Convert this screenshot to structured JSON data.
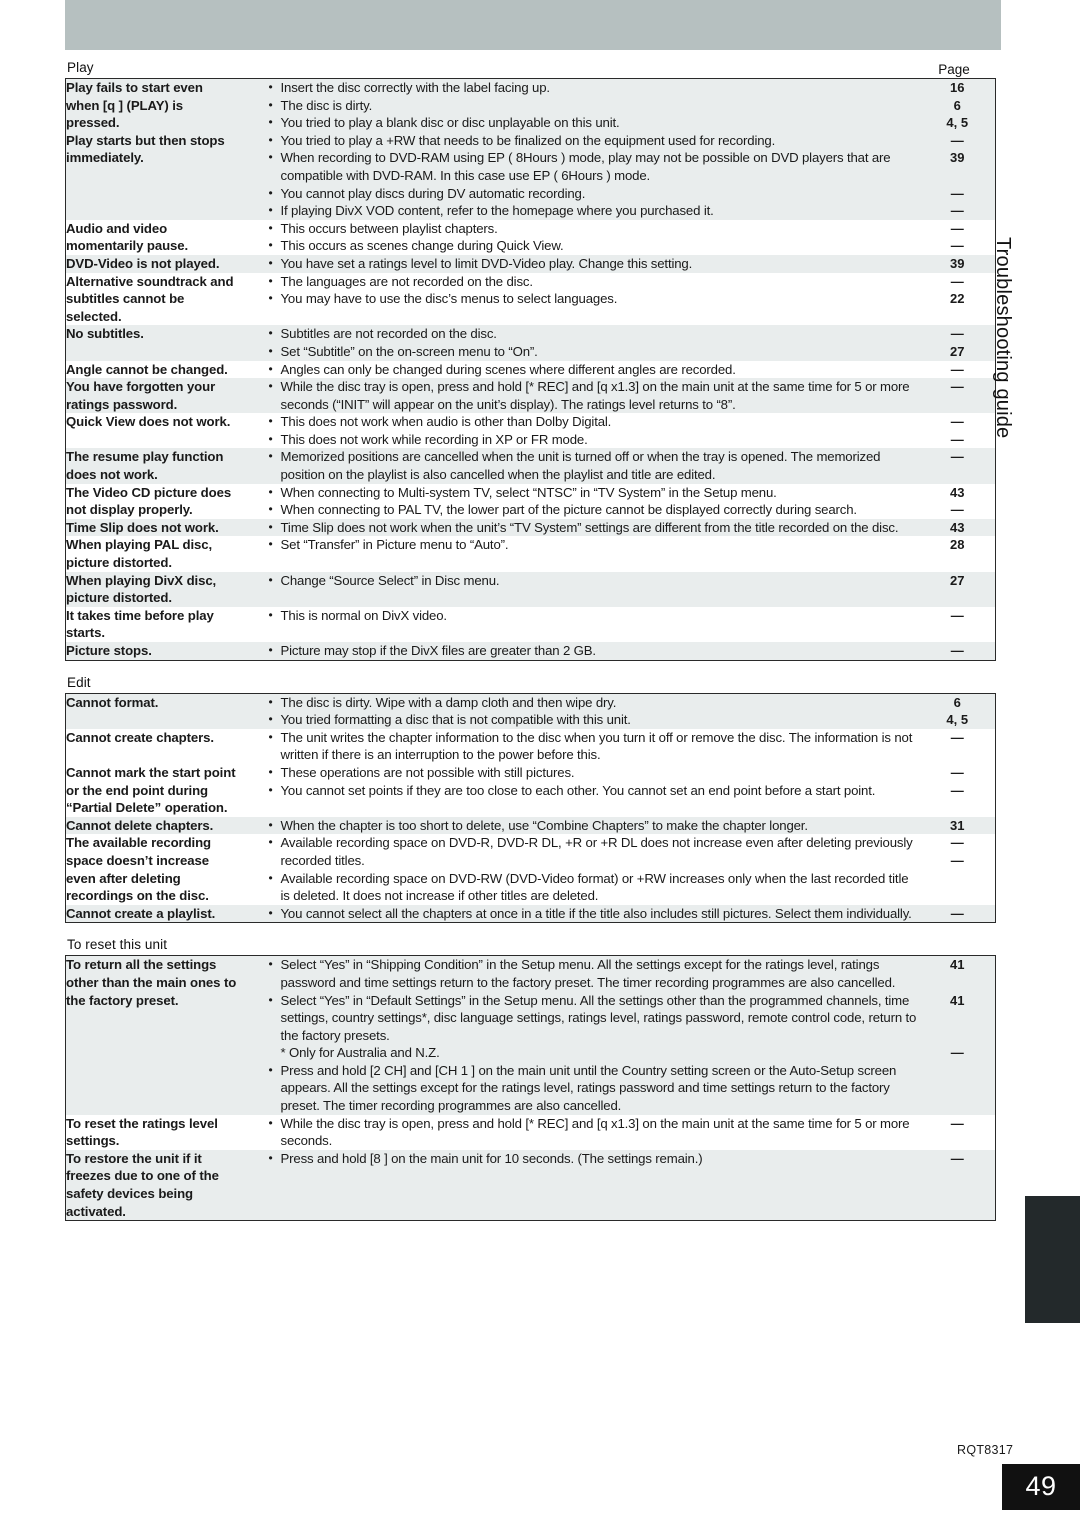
{
  "document": {
    "side_title": "Troubleshooting guide",
    "doc_code": "RQT8317",
    "page_number": "49",
    "page_column_header": "Page"
  },
  "sections": [
    {
      "label": "Play",
      "rows": [
        {
          "shaded": true,
          "symptom": [
            "Play fails to start even",
            "when [q ] (PLAY) is",
            "pressed.",
            "Play starts but then stops",
            "immediately."
          ],
          "remedies": [
            {
              "text": "Insert the disc correctly with the label facing up.",
              "bullet": true
            },
            {
              "text": "The disc is dirty.",
              "bullet": true
            },
            {
              "text": "You tried to play a blank disc or disc unplayable on this unit.",
              "bullet": true
            },
            {
              "text": "You tried to play a +RW that needs to be finalized on the equipment used for recording.",
              "bullet": true
            },
            {
              "text": "When recording to DVD-RAM using EP ( 8Hours ) mode, play may not be possible on DVD players that are compatible with DVD-RAM. In this case use EP ( 6Hours ) mode.",
              "bullet": true
            },
            {
              "text": "You cannot play discs during DV automatic recording.",
              "bullet": true
            },
            {
              "text": "If playing DivX VOD content, refer to the homepage where you purchased it.",
              "bullet": true
            }
          ],
          "pages": [
            "16",
            "6",
            "4, 5",
            "—",
            "39",
            "",
            "—",
            "—"
          ]
        },
        {
          "shaded": false,
          "symptom": [
            "Audio and video",
            "momentarily pause."
          ],
          "remedies": [
            {
              "text": "This occurs between playlist chapters.",
              "bullet": true
            },
            {
              "text": "This occurs as scenes change during Quick View.",
              "bullet": true
            }
          ],
          "pages": [
            "—",
            "—"
          ]
        },
        {
          "shaded": true,
          "symptom": [
            "DVD-Video is not played."
          ],
          "remedies": [
            {
              "text": "You have set a ratings level to limit DVD-Video play. Change this setting.",
              "bullet": true
            }
          ],
          "pages": [
            "39"
          ]
        },
        {
          "shaded": false,
          "symptom": [
            "Alternative soundtrack and",
            "subtitles cannot be",
            "selected."
          ],
          "remedies": [
            {
              "text": "The languages are not recorded on the disc.",
              "bullet": true
            },
            {
              "text": "You may have to use the disc’s menus to select languages.",
              "bullet": true
            }
          ],
          "pages": [
            "—",
            "22"
          ]
        },
        {
          "shaded": true,
          "symptom": [
            "No subtitles."
          ],
          "remedies": [
            {
              "text": "Subtitles are not recorded on the disc.",
              "bullet": true
            },
            {
              "text": "Set “Subtitle” on the on-screen menu to “On”.",
              "bullet": true
            }
          ],
          "pages": [
            "—",
            "27"
          ]
        },
        {
          "shaded": false,
          "symptom": [
            "Angle cannot be changed."
          ],
          "remedies": [
            {
              "text": "Angles can only be changed during scenes where different angles are recorded.",
              "bullet": true
            }
          ],
          "pages": [
            "—"
          ]
        },
        {
          "shaded": true,
          "symptom": [
            "You have forgotten your",
            "ratings password."
          ],
          "remedies": [
            {
              "text": "While the disc tray is open, press and hold [*  REC] and [q  x1.3] on the main unit at the same time for 5 or more seconds (“INIT” will appear on the unit’s display). The ratings level returns to “8”.",
              "bullet": true
            }
          ],
          "pages": [
            "—"
          ]
        },
        {
          "shaded": false,
          "symptom": [
            "Quick View does not work."
          ],
          "remedies": [
            {
              "text": "This does not work when audio is other than Dolby Digital.",
              "bullet": true
            },
            {
              "text": "This does not work while recording in XP or FR mode.",
              "bullet": true
            }
          ],
          "pages": [
            "—",
            "—"
          ]
        },
        {
          "shaded": true,
          "symptom": [
            "The resume play function",
            "does not work."
          ],
          "remedies": [
            {
              "text": "Memorized positions are cancelled when the unit is turned off or when the tray is opened. The memorized position on the playlist is also cancelled when the playlist and title are edited.",
              "bullet": true
            }
          ],
          "pages": [
            "—"
          ]
        },
        {
          "shaded": false,
          "symptom": [
            "The Video CD picture does",
            "not display properly."
          ],
          "remedies": [
            {
              "text": "When connecting to Multi-system TV, select “NTSC” in “TV System” in the Setup menu.",
              "bullet": true
            },
            {
              "text": "When connecting to PAL TV, the lower part of the picture cannot be displayed correctly during search.",
              "bullet": true
            }
          ],
          "pages": [
            "43",
            "—"
          ]
        },
        {
          "shaded": true,
          "symptom": [
            "Time Slip does not work."
          ],
          "remedies": [
            {
              "text": "Time Slip does not work when the unit’s “TV System” settings are different from the title recorded on the disc.",
              "bullet": true
            }
          ],
          "pages": [
            "43"
          ]
        },
        {
          "shaded": false,
          "symptom": [
            "When playing PAL disc,",
            "picture distorted."
          ],
          "remedies": [
            {
              "text": "Set “Transfer” in Picture menu to “Auto”.",
              "bullet": true
            }
          ],
          "pages": [
            "28"
          ]
        },
        {
          "shaded": true,
          "symptom": [
            "When playing DivX disc,",
            "picture distorted."
          ],
          "remedies": [
            {
              "text": "Change “Source Select” in Disc menu.",
              "bullet": true
            }
          ],
          "pages": [
            "27"
          ]
        },
        {
          "shaded": false,
          "symptom": [
            "It takes time before play",
            "starts."
          ],
          "remedies": [
            {
              "text": "This is normal on DivX video.",
              "bullet": true
            }
          ],
          "pages": [
            "—"
          ]
        },
        {
          "shaded": true,
          "symptom": [
            "Picture stops."
          ],
          "remedies": [
            {
              "text": "Picture may stop if the DivX files are greater than 2 GB.",
              "bullet": true
            }
          ],
          "pages": [
            "—"
          ]
        }
      ]
    },
    {
      "label": "Edit",
      "rows": [
        {
          "shaded": true,
          "symptom": [
            "Cannot format."
          ],
          "remedies": [
            {
              "text": "The disc is dirty. Wipe with a damp cloth and then wipe dry.",
              "bullet": true
            },
            {
              "text": "You tried formatting a disc that is not compatible with this unit.",
              "bullet": true
            }
          ],
          "pages": [
            "6",
            "4, 5"
          ]
        },
        {
          "shaded": false,
          "symptom": [
            "Cannot create chapters."
          ],
          "remedies": [
            {
              "text": "The unit writes the chapter information to the disc when you turn it off or remove the disc. The information is not written if there is an interruption to the power before this.",
              "bullet": true
            }
          ],
          "pages": [
            "—"
          ]
        },
        {
          "shaded": false,
          "symptom": [
            "Cannot mark the start point",
            "or the end point during",
            "“Partial Delete” operation."
          ],
          "remedies": [
            {
              "text": "These operations are not possible with still pictures.",
              "bullet": true
            },
            {
              "text": "You cannot set points if they are too close to each other. You cannot set an end point before a start point.",
              "bullet": true
            }
          ],
          "pages": [
            "—",
            "—"
          ]
        },
        {
          "shaded": true,
          "symptom": [
            "Cannot delete chapters."
          ],
          "remedies": [
            {
              "text": "When the chapter is too short to delete, use “Combine Chapters” to make the chapter longer.",
              "bullet": true
            }
          ],
          "pages": [
            "31"
          ]
        },
        {
          "shaded": false,
          "symptom": [
            "The available recording",
            "space doesn’t increase",
            "even after deleting",
            "recordings on the disc."
          ],
          "remedies": [
            {
              "text": "Available recording space on DVD-R, DVD-R DL, +R or +R DL does not increase even after deleting previously recorded titles.",
              "bullet": true
            },
            {
              "text": "Available recording space on DVD-RW (DVD-Video format) or +RW increases only when the last recorded title is deleted. It does not increase if other titles are deleted.",
              "bullet": true
            }
          ],
          "pages": [
            "—",
            "—"
          ]
        },
        {
          "shaded": true,
          "symptom": [
            "Cannot create a playlist."
          ],
          "remedies": [
            {
              "text": "You cannot select all the chapters at once in a title if the title also includes still pictures. Select them individually.",
              "bullet": true
            }
          ],
          "pages": [
            "—"
          ]
        }
      ]
    },
    {
      "label": "To reset this unit",
      "rows": [
        {
          "shaded": true,
          "symptom": [
            "To return all the settings",
            "other than the main ones to",
            "the factory preset."
          ],
          "remedies": [
            {
              "text": "Select “Yes” in “Shipping Condition” in the Setup menu. All the settings except for the ratings level, ratings password and time settings return to the factory preset. The timer recording programmes are also cancelled.",
              "bullet": true
            },
            {
              "text": "Select “Yes” in “Default Settings” in the Setup menu. All the settings other than the programmed channels, time settings, country settings*, disc language settings, ratings level, ratings password, remote control code, return to the factory presets.",
              "bullet": true
            },
            {
              "text": "* Only for Australia and N.Z.",
              "bullet": false
            },
            {
              "text": "Press and hold [2  CH] and [CH 1 ] on the main unit until the Country setting screen or the Auto-Setup screen appears. All the settings except for the ratings level, ratings password and time settings return to the factory preset. The timer recording programmes are also cancelled.",
              "bullet": true
            }
          ],
          "pages": [
            "41",
            "",
            "41",
            "",
            "",
            "—",
            ""
          ]
        },
        {
          "shaded": false,
          "symptom": [
            "To reset the ratings level",
            "settings."
          ],
          "remedies": [
            {
              "text": "While the disc tray is open, press and hold [*  REC] and [q  x1.3] on the main unit at the same time for 5 or more seconds.",
              "bullet": true
            }
          ],
          "pages": [
            "—"
          ]
        },
        {
          "shaded": true,
          "symptom": [
            "To restore the unit if it",
            "freezes due to one of the",
            "safety devices being",
            "activated."
          ],
          "remedies": [
            {
              "text": "Press and hold [8  ] on the main unit for 10 seconds. (The settings remain.)",
              "bullet": true
            }
          ],
          "pages": [
            "—"
          ]
        }
      ]
    }
  ]
}
